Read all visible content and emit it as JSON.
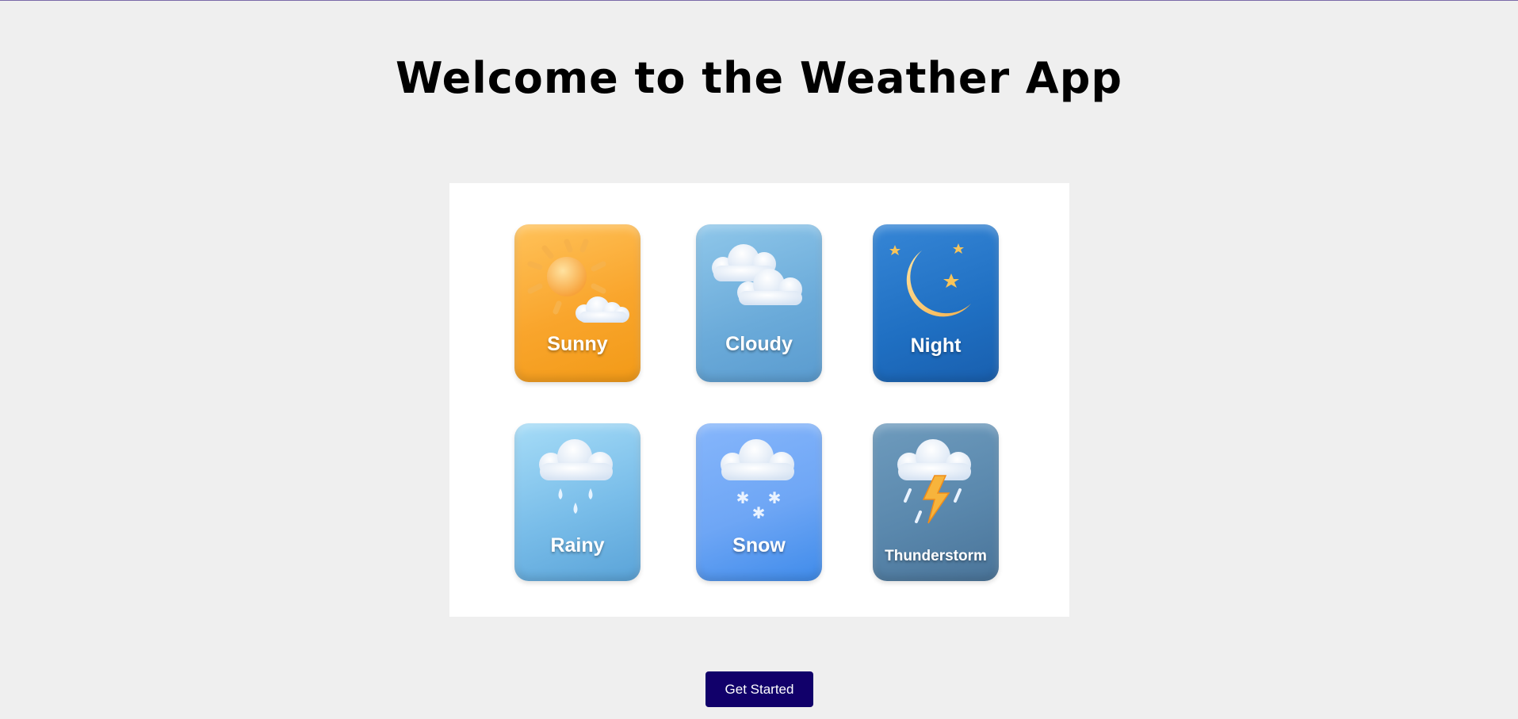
{
  "page": {
    "title": "Welcome to the Weather App"
  },
  "tiles": [
    {
      "label": "Sunny",
      "icon": "sun-cloud-icon",
      "color": "#f9a52c"
    },
    {
      "label": "Cloudy",
      "icon": "cloud-icon",
      "color": "#6aaad9"
    },
    {
      "label": "Night",
      "icon": "moon-stars-icon",
      "color": "#1f6fc2"
    },
    {
      "label": "Rainy",
      "icon": "rain-cloud-icon",
      "color": "#79bde9"
    },
    {
      "label": "Snow",
      "icon": "snow-cloud-icon",
      "color": "#6ea6f5"
    },
    {
      "label": "Thunderstorm",
      "icon": "thunderstorm-icon",
      "color": "#5a88ad"
    }
  ],
  "actions": {
    "get_started_label": "Get Started",
    "button_color": "#11006a"
  }
}
